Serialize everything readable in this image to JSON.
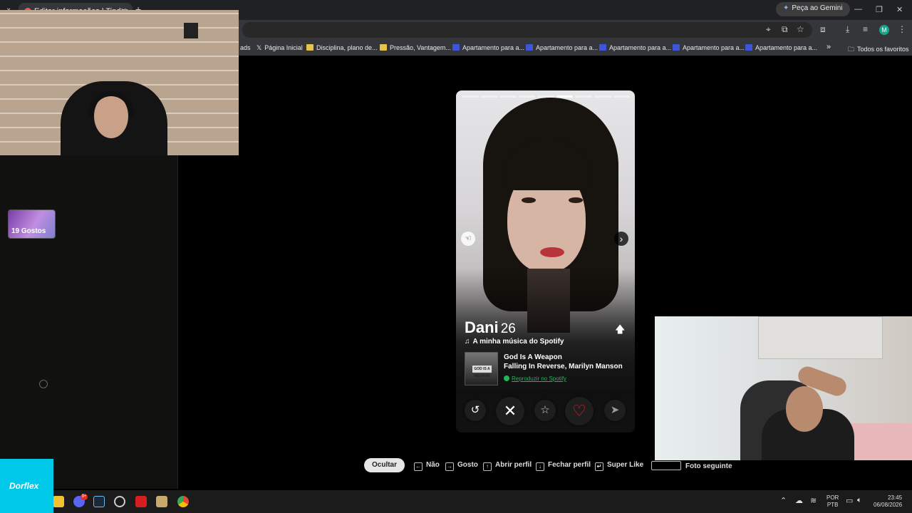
{
  "browser": {
    "tab_title": "Editar informações | Tinder",
    "tab_close": "✕",
    "new_tab": "+",
    "tab_menu": "⌄",
    "gemini_label": "Peça ao Gemini",
    "avatar_letter": "M",
    "window_controls": [
      "—",
      "❐",
      "✕"
    ]
  },
  "bookmarks": {
    "items": [
      {
        "label": "ads",
        "icon": "folder-icon"
      },
      {
        "label": "Página Inicial",
        "icon": "x-icon"
      },
      {
        "label": "Disciplina, plano de...",
        "icon": "folder-icon"
      },
      {
        "label": "Pressão, Vantagem...",
        "icon": "folder-icon"
      },
      {
        "label": "Apartamento para a...",
        "icon": "sa-icon"
      },
      {
        "label": "Apartamento para a...",
        "icon": "sa-icon"
      },
      {
        "label": "Apartamento para a...",
        "icon": "sa-icon"
      },
      {
        "label": "Apartamento para a...",
        "icon": "sa-icon"
      },
      {
        "label": "Apartamento para a...",
        "icon": "sa-icon"
      }
    ],
    "overflow": "»",
    "all_favorites": "Todos os favoritos"
  },
  "sidebar": {
    "likes_label": "19 Gostos"
  },
  "profile": {
    "name": "Dani",
    "age": "26",
    "photo_index": 5,
    "photo_count": 9,
    "spotify_heading": "A minha música do Spotify",
    "song_title": "God Is A Weapon",
    "song_artist": "Falling In Reverse, Marilyn Manson",
    "play_link": "Reproduzir no Spotify",
    "album_sign": "GOD IS A WEAPON"
  },
  "actions": {
    "rewind": "↺",
    "nope": "✕",
    "super_like": "☆",
    "like": "♡",
    "boost": "➤"
  },
  "shortcuts": {
    "hide": "Ocultar",
    "items": [
      {
        "key": "←",
        "label": "Não"
      },
      {
        "key": "→",
        "label": "Gosto"
      },
      {
        "key": "↑",
        "label": "Abrir perfil"
      },
      {
        "key": "↓",
        "label": "Fechar perfil"
      },
      {
        "key": "↵",
        "label": "Super Like"
      }
    ],
    "next_photo": "Foto seguinte"
  },
  "taskbar": {
    "dorflex": "Dorflex",
    "discord_badge": "9+",
    "lang_top": "POR",
    "lang_bottom": "PTB",
    "time": "23:45",
    "date": "06/08/2026"
  },
  "colors": {
    "tinder_red": "#fd5068",
    "spotify_green": "#1db954",
    "heart_red": "#e3242b",
    "dorflex_cyan": "#00c8e8"
  }
}
